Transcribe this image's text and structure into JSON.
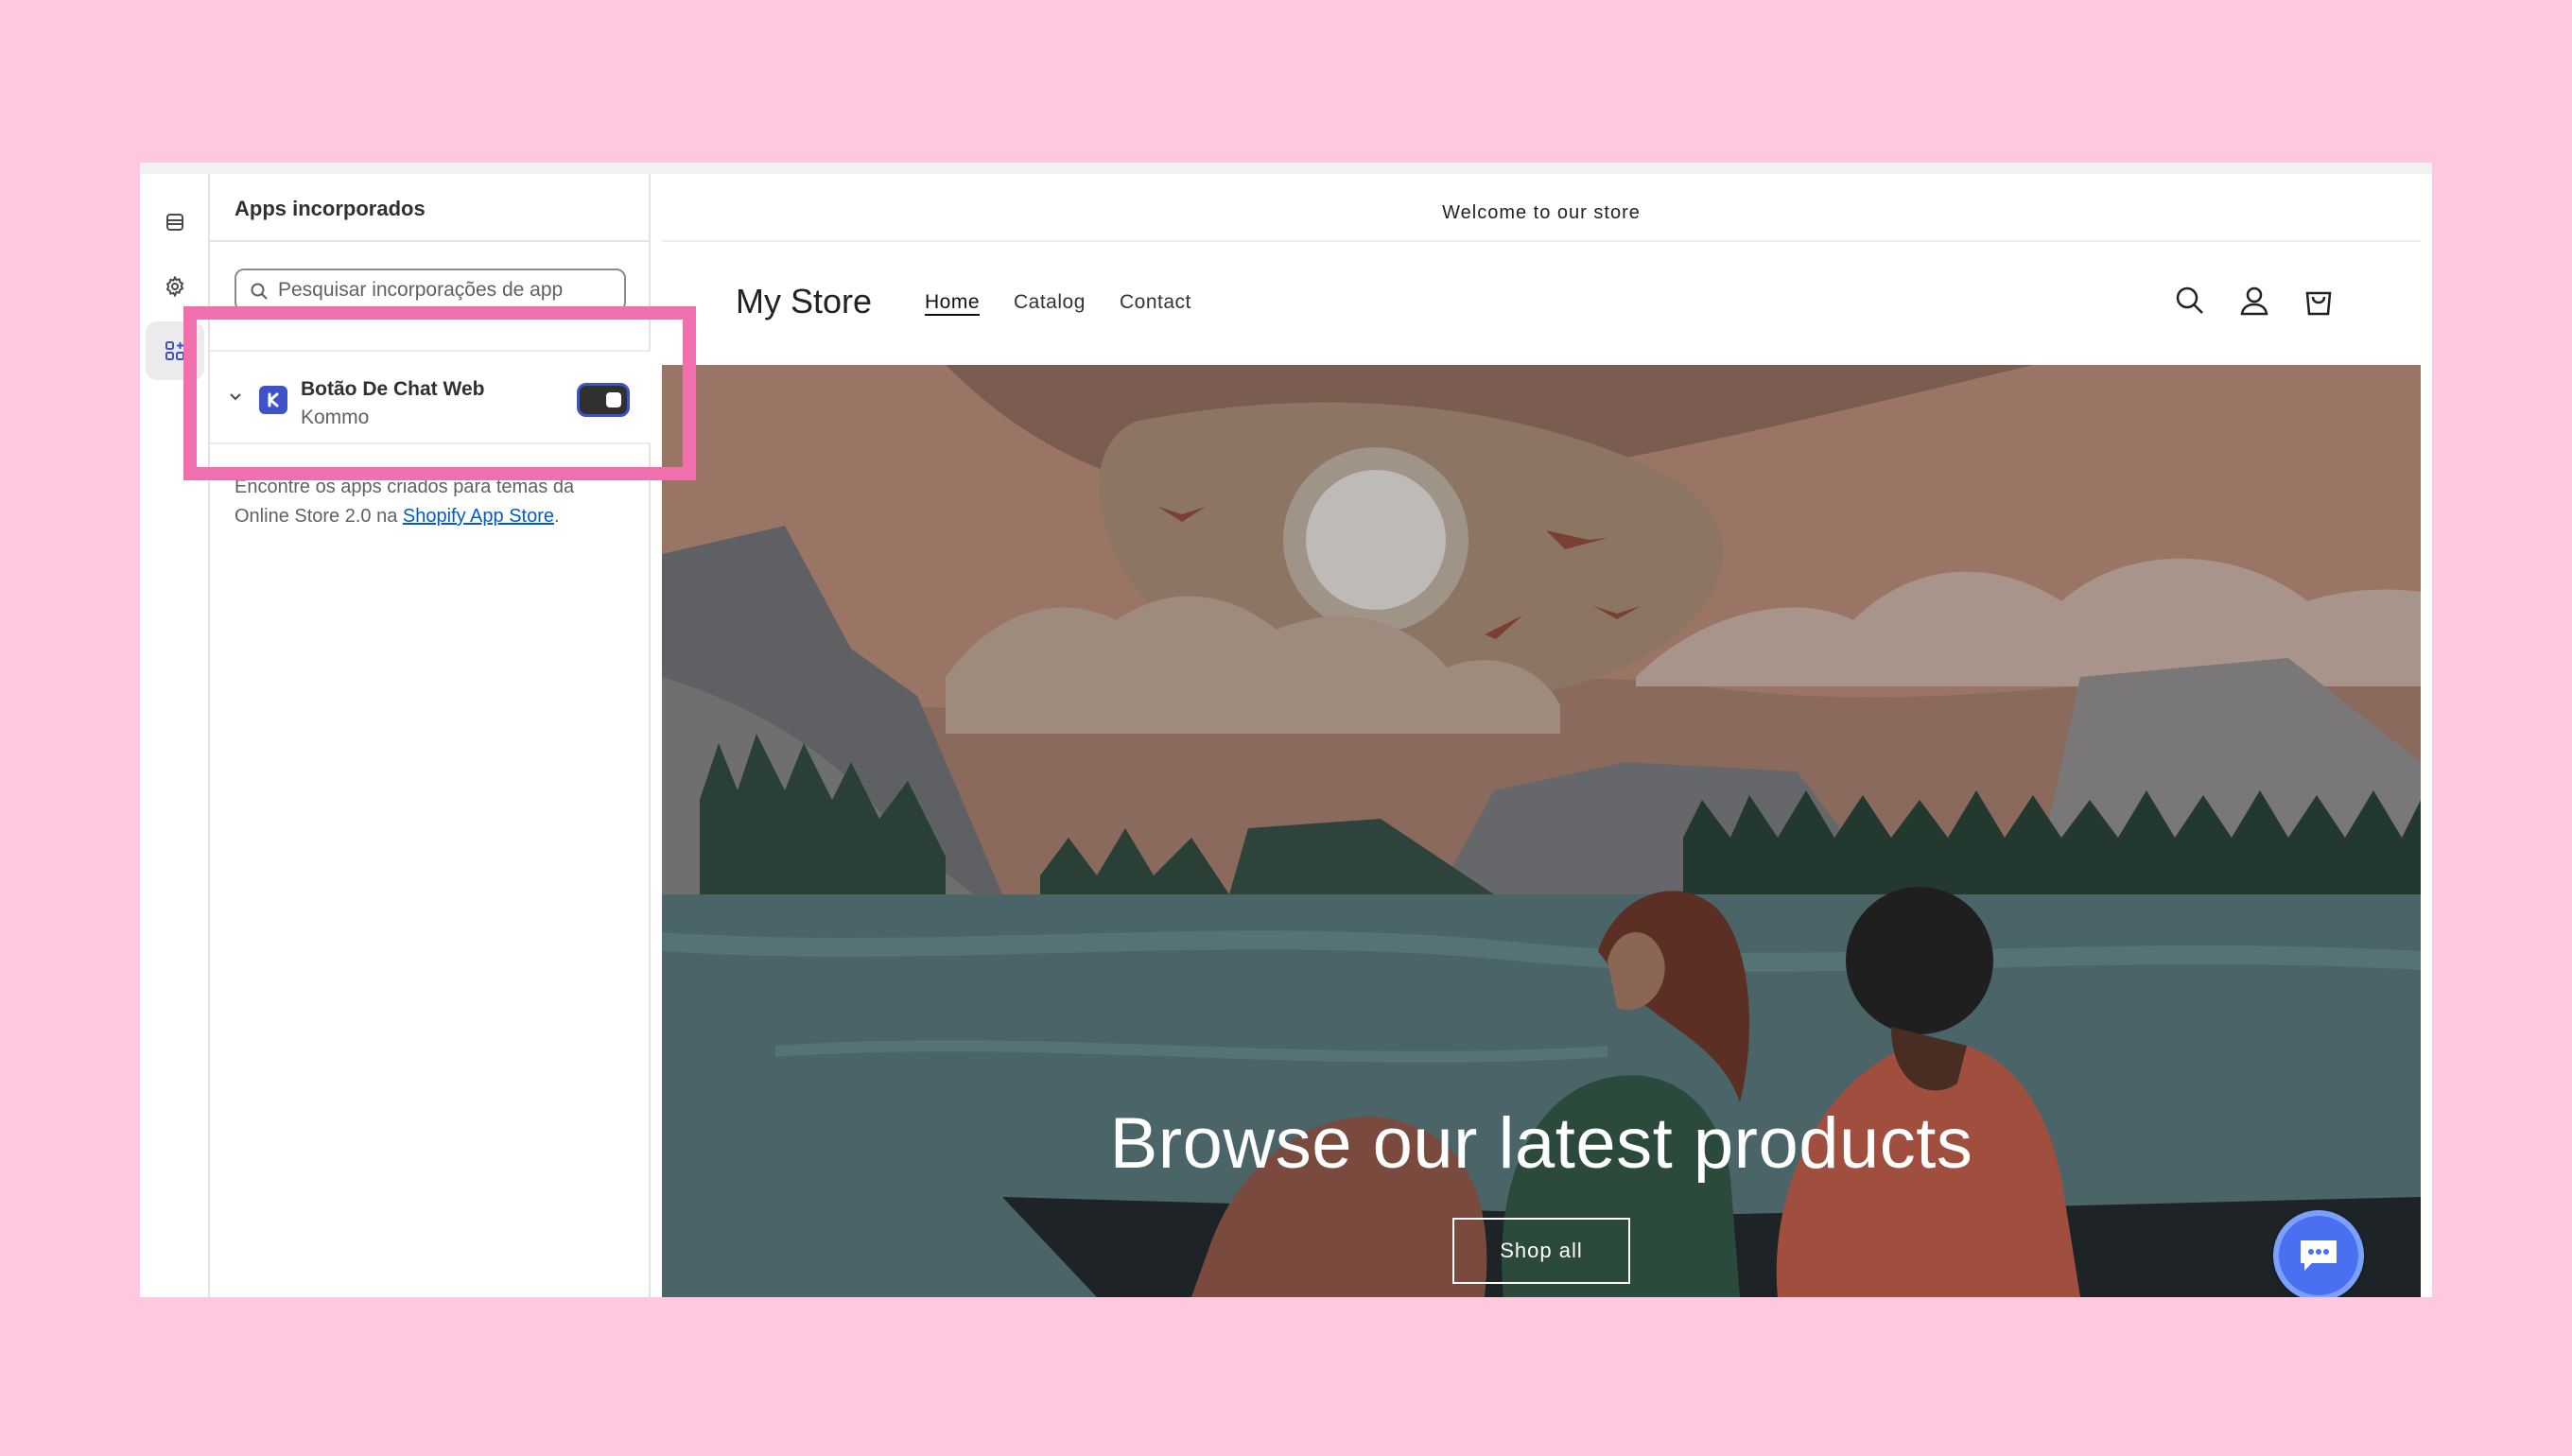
{
  "sidebar_rail": {
    "icons": [
      "sections-icon",
      "settings-gear-icon",
      "app-embeds-icon"
    ],
    "active_index": 2
  },
  "panel": {
    "title": "Apps incorporados",
    "search_placeholder": "Pesquisar incorporações de app",
    "app": {
      "name": "Botão De Chat Web",
      "vendor": "Kommo",
      "enabled": true
    },
    "help_prefix": "Encontre os apps criados para temas da Online Store 2.0 na ",
    "help_link": "Shopify App Store",
    "help_suffix": "."
  },
  "preview": {
    "announcement": "Welcome to our store",
    "store_name": "My Store",
    "nav": [
      "Home",
      "Catalog",
      "Contact"
    ],
    "active_nav": "Home",
    "header_icons": [
      "search-icon",
      "account-icon",
      "cart-icon"
    ],
    "hero_title": "Browse our latest products",
    "hero_button": "Shop all",
    "chat_widget_icon": "chat-bubble-icon"
  },
  "colors": {
    "page_background": "#ffc8e1",
    "highlight": "#f26fad",
    "accent": "#3f53c8",
    "chat_button": "#4a6ff0"
  }
}
